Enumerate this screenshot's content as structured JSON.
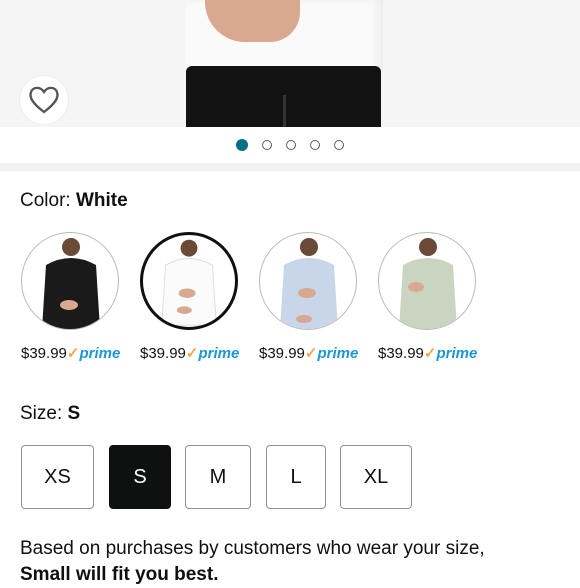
{
  "hero": {
    "image": "product-photo-white-blouse",
    "active_slide": 1,
    "slide_count": 5
  },
  "color": {
    "label": "Color:",
    "selected": "White"
  },
  "swatches": [
    {
      "name": "Black",
      "shirt_color": "#1a1a1a",
      "price": "$39.99",
      "prime": "prime"
    },
    {
      "name": "White",
      "shirt_color": "#fbfbfb",
      "price": "$39.99",
      "prime": "prime"
    },
    {
      "name": "Light Blue",
      "shirt_color": "#c9d6ea",
      "price": "$39.99",
      "prime": "prime"
    },
    {
      "name": "Sage",
      "shirt_color": "#c9d5c1",
      "price": "$39.99",
      "prime": "prime"
    }
  ],
  "size": {
    "label": "Size:",
    "selected": "S",
    "options": [
      "XS",
      "S",
      "M",
      "L",
      "XL"
    ]
  },
  "fit": {
    "text": "Based on purchases by customers who wear your size,",
    "bold": "Small will fit you best."
  },
  "colors": {
    "accent": "#007185",
    "prime": "#1a98d5",
    "check": "#f3a847"
  }
}
